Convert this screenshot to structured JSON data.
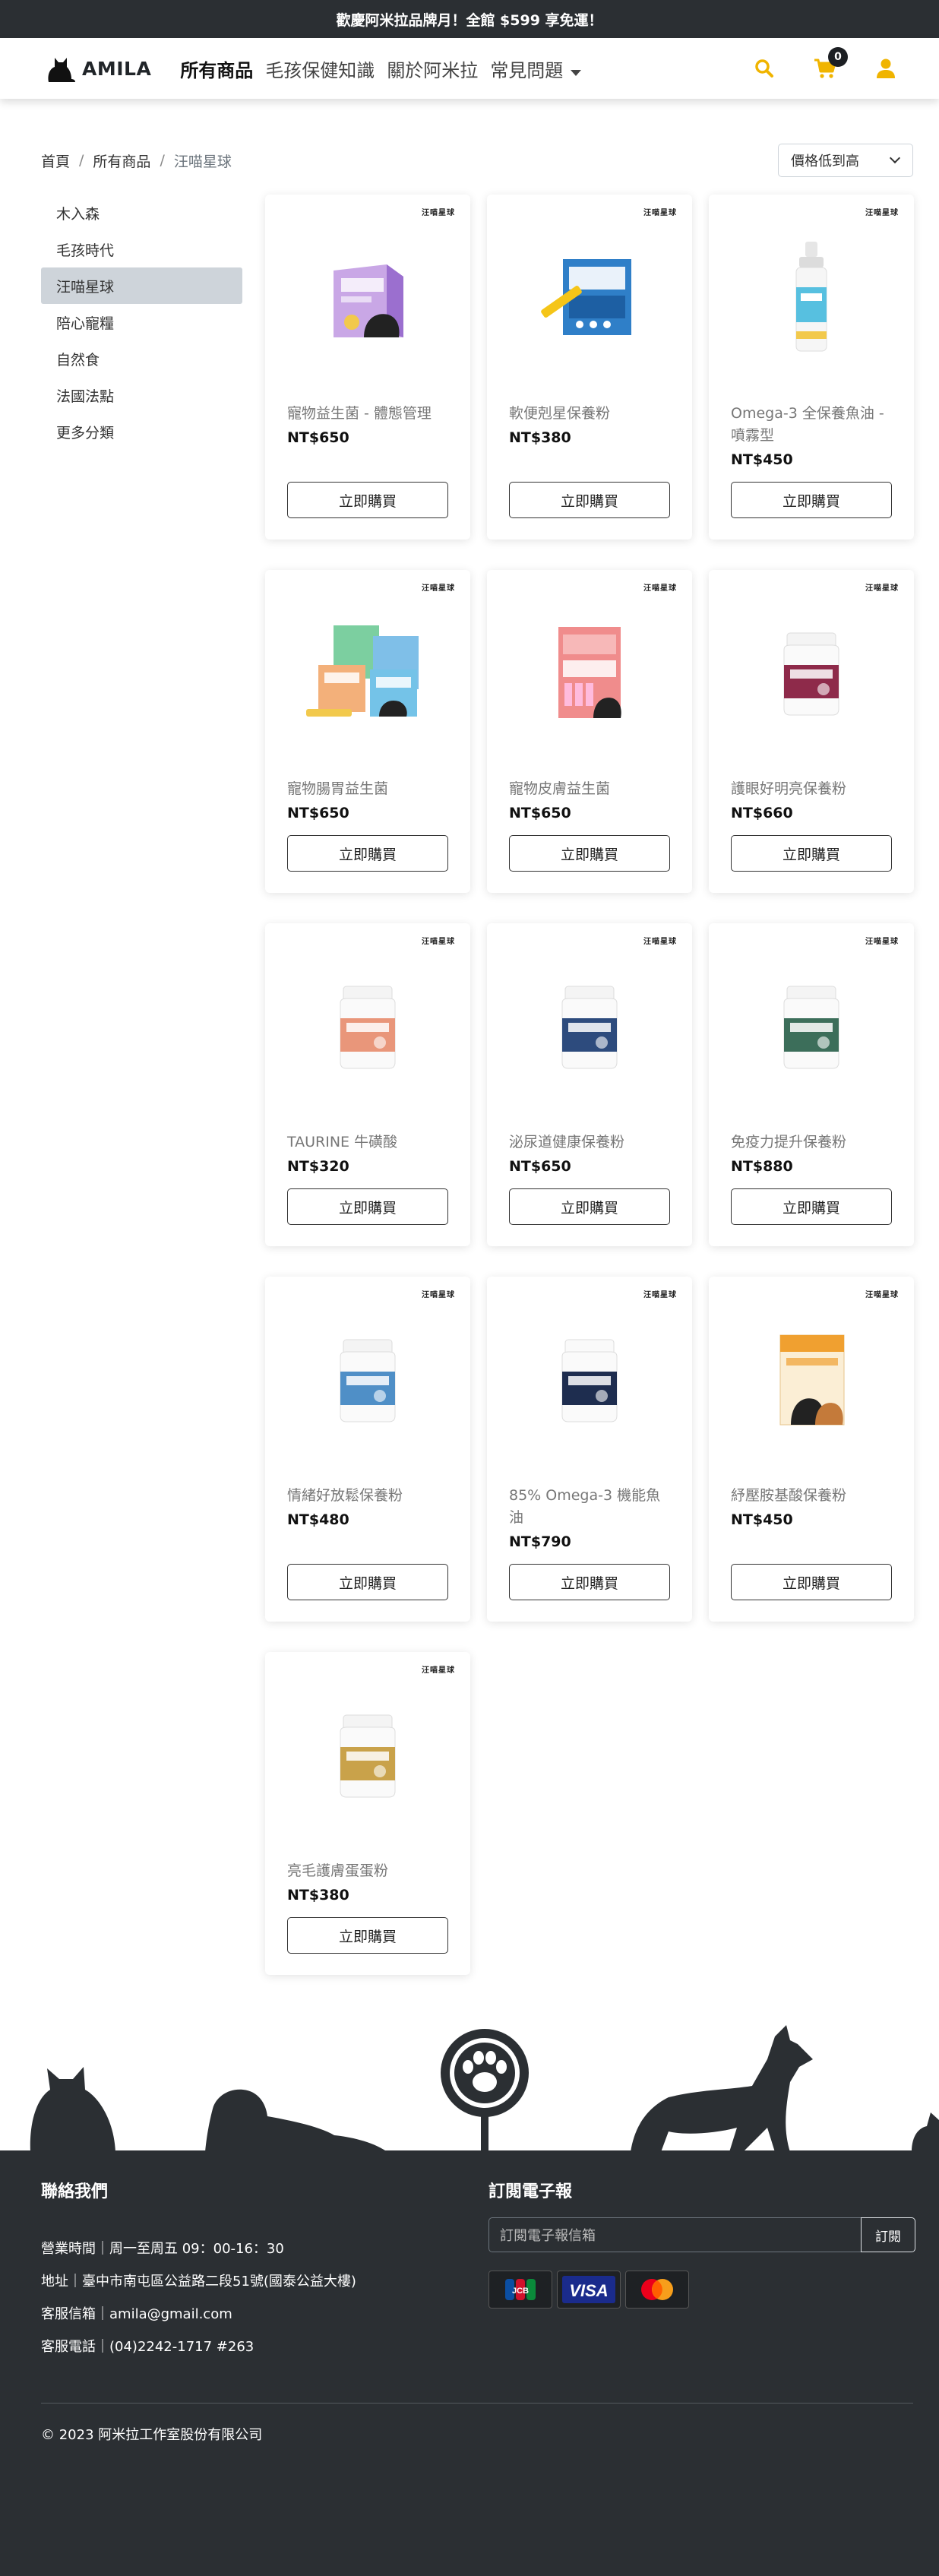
{
  "announcement": "歡慶阿米拉品牌月！全館 $599 享免運！",
  "header": {
    "logo_text": "AMILA",
    "nav": [
      {
        "label": "所有商品",
        "active": true
      },
      {
        "label": "毛孩保健知識",
        "active": false
      },
      {
        "label": "關於阿米拉",
        "active": false
      },
      {
        "label": "常見問題",
        "active": false,
        "dropdown": true
      }
    ],
    "cart_count": "0",
    "icons": [
      "search-icon",
      "cart-icon",
      "user-icon"
    ],
    "accent_color": "#f0b400"
  },
  "breadcrumb": [
    "首頁",
    "所有商品",
    "汪喵星球"
  ],
  "sort": {
    "selected": "價格低到高"
  },
  "sidebar": {
    "items": [
      {
        "label": "木入森",
        "active": false
      },
      {
        "label": "毛孩時代",
        "active": false
      },
      {
        "label": "汪喵星球",
        "active": true
      },
      {
        "label": "陪心寵糧",
        "active": false
      },
      {
        "label": "自然食",
        "active": false
      },
      {
        "label": "法國法點",
        "active": false
      },
      {
        "label": "更多分類",
        "active": false
      }
    ]
  },
  "products": [
    {
      "name": "寵物益生菌 - 體態管理",
      "price": "NT$650",
      "button": "立即購買",
      "brand": "汪喵星球",
      "image": "box-purple"
    },
    {
      "name": "軟便剋星保養粉",
      "price": "NT$380",
      "button": "立即購買",
      "brand": "汪喵星球",
      "image": "box-blue"
    },
    {
      "name": "Omega-3 全保養魚油 - 噴霧型",
      "price": "NT$450",
      "button": "立即購買",
      "brand": "汪喵星球",
      "image": "spray"
    },
    {
      "name": "寵物腸胃益生菌",
      "price": "NT$650",
      "button": "立即購買",
      "brand": "汪喵星球",
      "image": "boxes-multi"
    },
    {
      "name": "寵物皮膚益生菌",
      "price": "NT$650",
      "button": "立即購買",
      "brand": "汪喵星球",
      "image": "box-pink"
    },
    {
      "name": "護眼好明亮保養粉",
      "price": "NT$660",
      "button": "立即購買",
      "brand": "汪喵星球",
      "image": "jar-maroon"
    },
    {
      "name": "TAURINE 牛磺酸",
      "price": "NT$320",
      "button": "立即購買",
      "brand": "汪喵星球",
      "image": "jar-salmon"
    },
    {
      "name": "泌尿道健康保養粉",
      "price": "NT$650",
      "button": "立即購買",
      "brand": "汪喵星球",
      "image": "jar-navy"
    },
    {
      "name": "免疫力提升保養粉",
      "price": "NT$880",
      "button": "立即購買",
      "brand": "汪喵星球",
      "image": "jar-green"
    },
    {
      "name": "情緒好放鬆保養粉",
      "price": "NT$480",
      "button": "立即購買",
      "brand": "汪喵星球",
      "image": "jar-lightblue"
    },
    {
      "name": "85% Omega-3 機能魚油",
      "price": "NT$790",
      "button": "立即購買",
      "brand": "汪喵星球",
      "image": "jar-darknavy"
    },
    {
      "name": "紓壓胺基酸保養粉",
      "price": "NT$450",
      "button": "立即購買",
      "brand": "汪喵星球",
      "image": "box-orange"
    },
    {
      "name": "亮毛護膚蛋蛋粉",
      "price": "NT$380",
      "button": "立即購買",
      "brand": "汪喵星球",
      "image": "jar-gold"
    }
  ],
  "footer": {
    "contact_title": "聯絡我們",
    "contact_lines": [
      "營業時間｜周一至周五 09：00-16：30",
      "地址｜臺中市南屯區公益路二段51號(國泰公益大樓)",
      "客服信箱｜amila@gmail.com",
      "客服電話｜(04)2242-1717 #263"
    ],
    "subscribe_title": "訂閱電子報",
    "subscribe_placeholder": "訂閱電子報信箱",
    "subscribe_button": "訂閱",
    "payments": [
      "JCB",
      "VISA",
      "mastercard"
    ],
    "copyright": "© 2023 阿米拉工作室股份有限公司"
  }
}
